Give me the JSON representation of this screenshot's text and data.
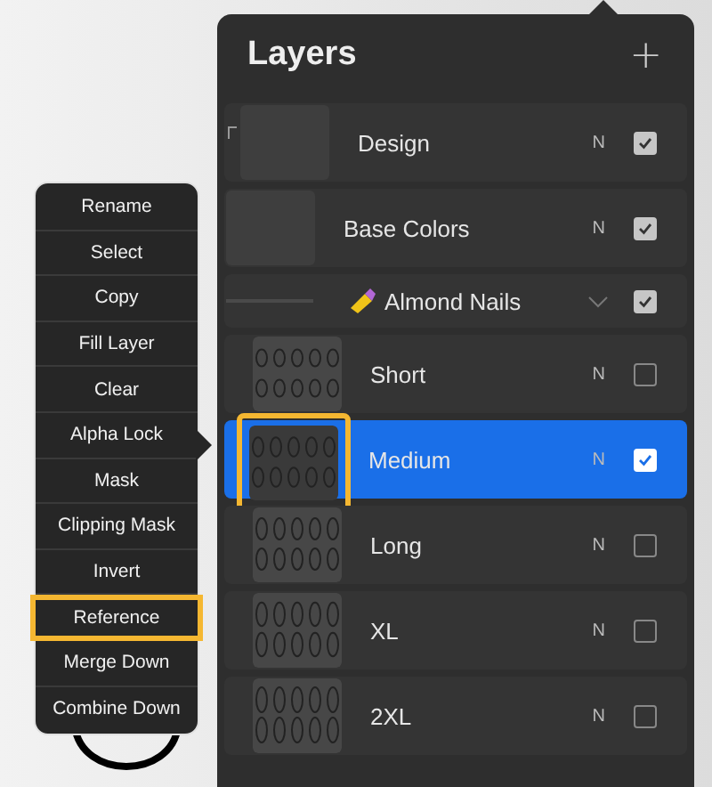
{
  "panel": {
    "title": "Layers",
    "add_label": "+"
  },
  "layers": [
    {
      "kind": "layer",
      "name": "Design",
      "blend": "N",
      "visible": true,
      "selected": false,
      "clipped": true,
      "highlighted": false,
      "child": false,
      "nails": false
    },
    {
      "kind": "layer",
      "name": "Base Colors",
      "blend": "N",
      "visible": true,
      "selected": false,
      "clipped": false,
      "highlighted": false,
      "child": false,
      "nails": false
    },
    {
      "kind": "group",
      "name": "Almond Nails",
      "visible": true,
      "expanded": true
    },
    {
      "kind": "layer",
      "name": "Short",
      "blend": "N",
      "visible": false,
      "selected": false,
      "clipped": false,
      "highlighted": false,
      "child": true,
      "nails": true
    },
    {
      "kind": "layer",
      "name": "Medium",
      "blend": "N",
      "visible": true,
      "selected": true,
      "clipped": false,
      "highlighted": true,
      "child": true,
      "nails": true
    },
    {
      "kind": "layer",
      "name": "Long",
      "blend": "N",
      "visible": false,
      "selected": false,
      "clipped": false,
      "highlighted": false,
      "child": true,
      "nails": true
    },
    {
      "kind": "layer",
      "name": "XL",
      "blend": "N",
      "visible": false,
      "selected": false,
      "clipped": false,
      "highlighted": false,
      "child": true,
      "nails": true
    },
    {
      "kind": "layer",
      "name": "2XL",
      "blend": "N",
      "visible": false,
      "selected": false,
      "clipped": false,
      "highlighted": false,
      "child": true,
      "nails": true
    }
  ],
  "menu": [
    {
      "label": "Rename",
      "highlighted": false
    },
    {
      "label": "Select",
      "highlighted": false
    },
    {
      "label": "Copy",
      "highlighted": false
    },
    {
      "label": "Fill Layer",
      "highlighted": false
    },
    {
      "label": "Clear",
      "highlighted": false
    },
    {
      "label": "Alpha Lock",
      "highlighted": false
    },
    {
      "label": "Mask",
      "highlighted": false
    },
    {
      "label": "Clipping Mask",
      "highlighted": false
    },
    {
      "label": "Invert",
      "highlighted": false
    },
    {
      "label": "Reference",
      "highlighted": true
    },
    {
      "label": "Merge Down",
      "highlighted": false
    },
    {
      "label": "Combine Down",
      "highlighted": false
    }
  ]
}
